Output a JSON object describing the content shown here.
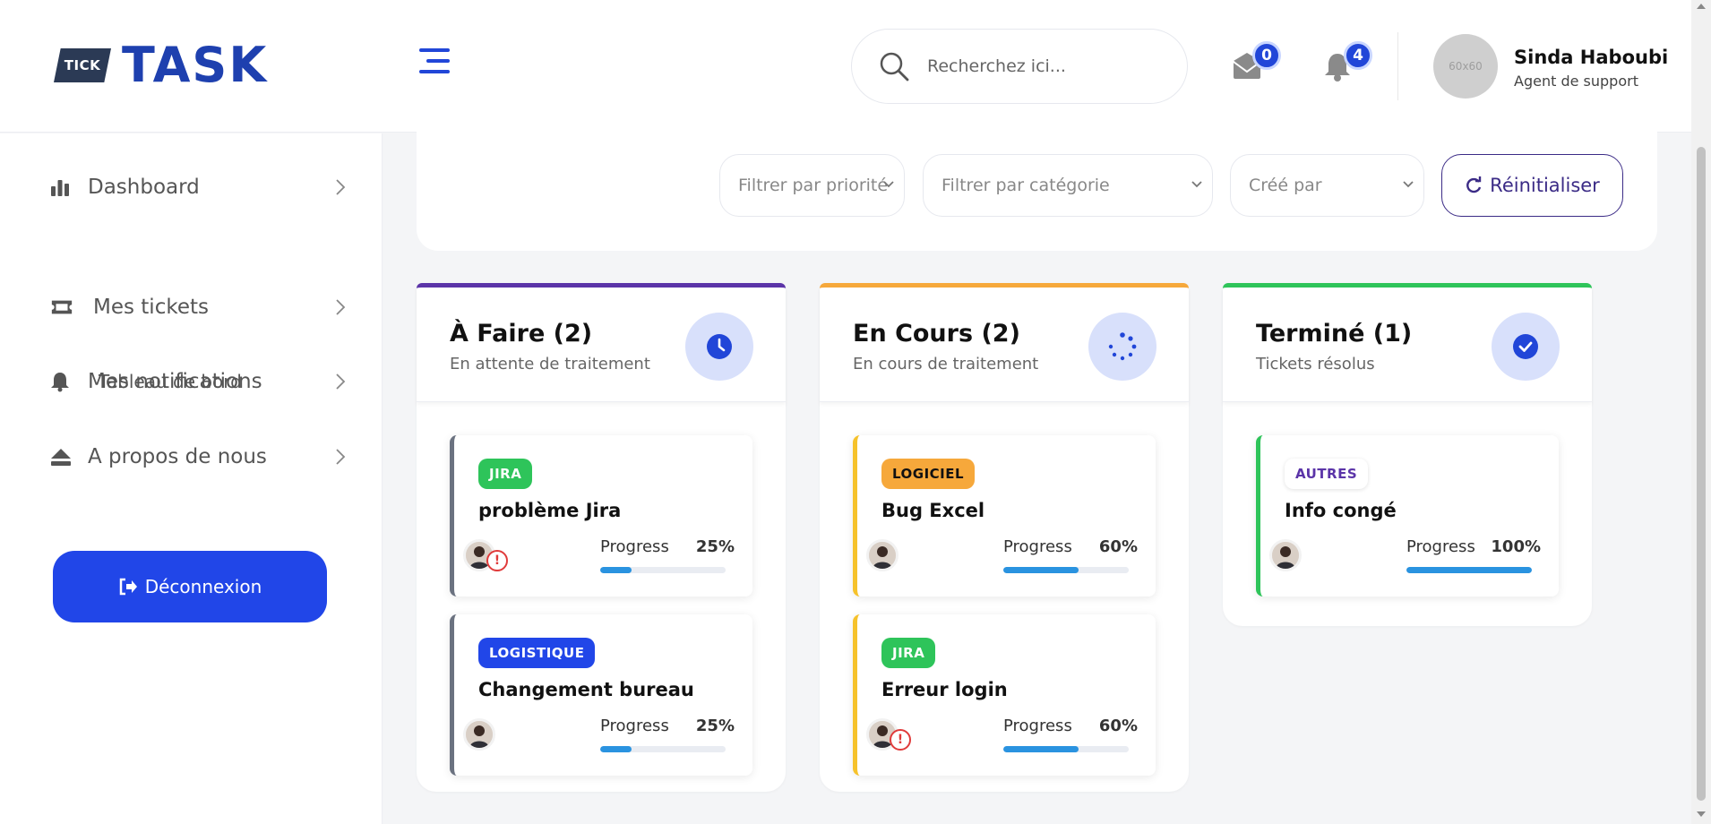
{
  "header": {
    "logo_tag": "TICK",
    "logo_word": "TASK",
    "search_placeholder": "Recherchez ici...",
    "messages_count": "0",
    "notifications_count": "4",
    "avatar_text": "60x60",
    "user_name": "Sinda Haboubi",
    "user_role": "Agent de support"
  },
  "sidebar": {
    "items": [
      {
        "label": "Dashboard",
        "icon": "bar-chart-icon"
      },
      {
        "label": "Mes tickets",
        "icon": "ticket-icon"
      },
      {
        "label": "Mes notifications",
        "icon": "bell-icon"
      },
      {
        "label": "A propos de nous",
        "icon": "eject-icon"
      }
    ],
    "sub_item": "Tableau de bord",
    "logout_label": "Déconnexion"
  },
  "filters": {
    "priority": "Filtrer par priorité",
    "category": "Filtrer par catégorie",
    "created_by": "Créé par",
    "reset_label": "Réinitialiser"
  },
  "columns": [
    {
      "title": "À Faire (2)",
      "subtitle": "En attente de traitement",
      "accent": "#5b34a8",
      "icon": "clock-icon",
      "tickets": [
        {
          "tag": "JIRA",
          "title": "problème Jira",
          "progress_label": "Progress",
          "progress": "25%",
          "progress_value": 25,
          "alert": true
        },
        {
          "tag": "LOGISTIQUE",
          "title": "Changement bureau",
          "progress_label": "Progress",
          "progress": "25%",
          "progress_value": 25,
          "alert": false
        }
      ]
    },
    {
      "title": "En Cours (2)",
      "subtitle": "En cours de traitement",
      "accent": "#f6a83b",
      "icon": "spinner-icon",
      "tickets": [
        {
          "tag": "LOGICIEL",
          "title": "Bug Excel",
          "progress_label": "Progress",
          "progress": "60%",
          "progress_value": 60,
          "alert": false
        },
        {
          "tag": "JIRA",
          "title": "Erreur login",
          "progress_label": "Progress",
          "progress": "60%",
          "progress_value": 60,
          "alert": true
        }
      ]
    },
    {
      "title": "Terminé (1)",
      "subtitle": "Tickets résolus",
      "accent": "#2ec45a",
      "icon": "check-icon",
      "tickets": [
        {
          "tag": "AUTRES",
          "title": "Info congé",
          "progress_label": "Progress",
          "progress": "100%",
          "progress_value": 100,
          "alert": false
        }
      ]
    }
  ],
  "colors": {
    "brand_blue": "#2146e8",
    "tag_jira": "#2ec45a",
    "tag_logistique": "#2146e8",
    "tag_logiciel": "#f6a83b",
    "tag_autres": "#5b34a8"
  }
}
